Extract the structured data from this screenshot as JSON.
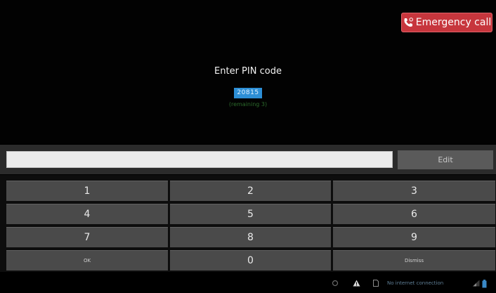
{
  "emergency": {
    "label": "Emergency call"
  },
  "prompt": {
    "title": "Enter PIN code",
    "pin_value": "20815",
    "remaining": "(remaining 3)"
  },
  "entry": {
    "value": "",
    "edit_label": "Edit"
  },
  "keypad": {
    "keys": [
      "1",
      "2",
      "3",
      "4",
      "5",
      "6",
      "7",
      "8",
      "9",
      "OK",
      "0",
      "Dismiss"
    ]
  },
  "status": {
    "text": "No internet connection",
    "icons": [
      "circle-icon",
      "warning-icon",
      "sd-card-icon",
      "signal-icon",
      "battery-icon"
    ],
    "accent": "#2d8fd6",
    "emergency_color": "#c7363d"
  }
}
